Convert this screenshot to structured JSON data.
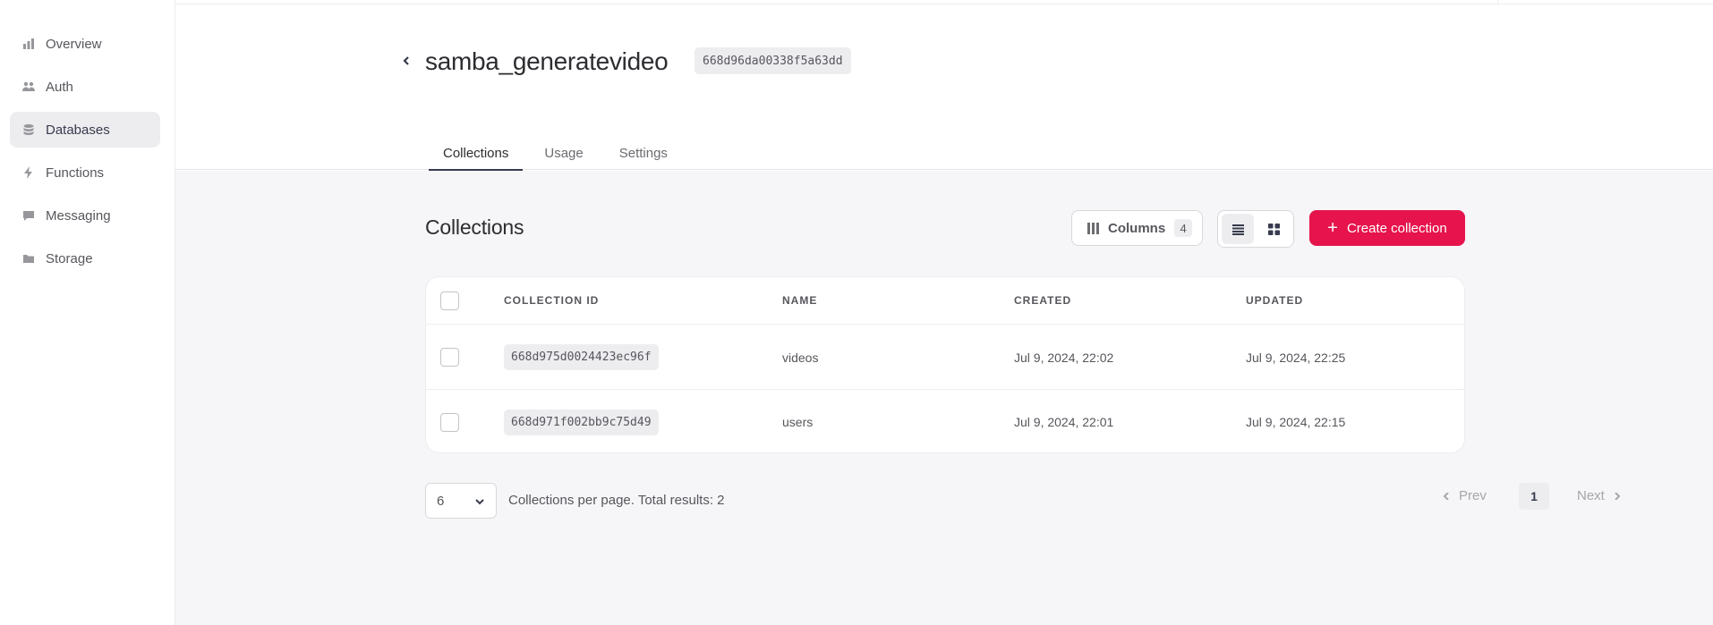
{
  "sidebar": {
    "items": [
      {
        "label": "Overview",
        "icon": "chart-bar-icon"
      },
      {
        "label": "Auth",
        "icon": "users-icon"
      },
      {
        "label": "Databases",
        "icon": "database-icon",
        "active": true
      },
      {
        "label": "Functions",
        "icon": "lightning-icon"
      },
      {
        "label": "Messaging",
        "icon": "chat-icon"
      },
      {
        "label": "Storage",
        "icon": "folder-icon"
      }
    ]
  },
  "header": {
    "title": "samba_generatevideo",
    "id": "668d96da00338f5a63dd",
    "tabs": [
      {
        "label": "Collections",
        "active": true
      },
      {
        "label": "Usage"
      },
      {
        "label": "Settings"
      }
    ]
  },
  "main": {
    "section_title": "Collections",
    "columns_label": "Columns",
    "columns_count": "4",
    "create_label": "Create collection",
    "accent_color": "#e6134c",
    "table": {
      "headers": [
        "COLLECTION ID",
        "NAME",
        "CREATED",
        "UPDATED"
      ],
      "rows": [
        {
          "id": "668d975d0024423ec96f",
          "name": "videos",
          "created": "Jul 9, 2024, 22:02",
          "updated": "Jul 9, 2024, 22:25"
        },
        {
          "id": "668d971f002bb9c75d49",
          "name": "users",
          "created": "Jul 9, 2024, 22:01",
          "updated": "Jul 9, 2024, 22:15"
        }
      ]
    },
    "pagination": {
      "per_page_value": "6",
      "per_page_text": "Collections per page. Total results: 2",
      "prev": "Prev",
      "page": "1",
      "next": "Next"
    }
  }
}
